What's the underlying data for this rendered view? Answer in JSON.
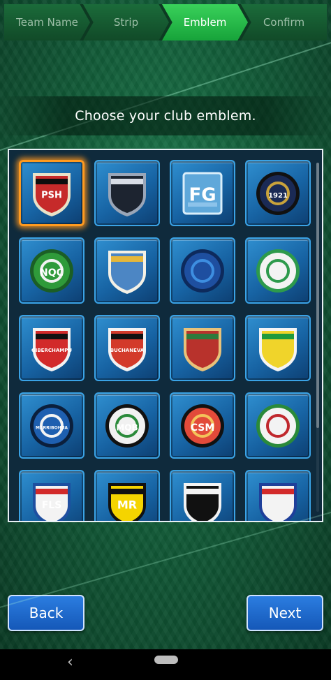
{
  "steps": [
    {
      "label": "Team Name"
    },
    {
      "label": "Strip"
    },
    {
      "label": "Emblem"
    },
    {
      "label": "Confirm"
    }
  ],
  "active_step": "Emblem",
  "instruction": "Choose your club emblem.",
  "emblems": [
    {
      "id": "psh",
      "text": "PSH",
      "icon": "psh-shield-crest",
      "selected": true
    },
    {
      "id": "lion",
      "text": "",
      "icon": "lion-head-crest",
      "selected": false
    },
    {
      "id": "fg",
      "text": "FG",
      "icon": "fg-monogram-crest",
      "selected": false
    },
    {
      "id": "herismakhgia",
      "text": "1921",
      "icon": "snake-scarab-crest",
      "selected": false
    },
    {
      "id": "nqc",
      "text": "NQC",
      "icon": "nqc-star-crest",
      "selected": false
    },
    {
      "id": "gharnetova",
      "text": "",
      "icon": "keys-shield-crest",
      "selected": false
    },
    {
      "id": "round-ball",
      "text": "",
      "icon": "blue-round-ball-crest",
      "selected": false
    },
    {
      "id": "celtic",
      "text": "",
      "icon": "green-white-round-crest",
      "selected": false
    },
    {
      "id": "giberchampu",
      "text": "GIBERCHAMPU",
      "icon": "red-black-stripes-crest",
      "selected": false
    },
    {
      "id": "buchaneva",
      "text": "BUCHANEVA",
      "icon": "castle-shield-crest",
      "selected": false
    },
    {
      "id": "monogram",
      "text": "",
      "icon": "red-green-monogram-crest",
      "selected": false
    },
    {
      "id": "green-yellow",
      "text": "",
      "icon": "green-yellow-shield-crest",
      "selected": false
    },
    {
      "id": "marribohua",
      "text": "MARRIBOHUA",
      "icon": "blue-round-crest",
      "selected": false
    },
    {
      "id": "mqb",
      "text": "MQB",
      "icon": "mqb-round-crest",
      "selected": false
    },
    {
      "id": "csm",
      "text": "CSM",
      "icon": "cosmopolitia-crest",
      "selected": false
    },
    {
      "id": "laurel",
      "text": "",
      "icon": "laurel-round-crest",
      "selected": false
    },
    {
      "id": "fls",
      "text": "FLS",
      "icon": "fls-shield-crest",
      "selected": false
    },
    {
      "id": "mr",
      "text": "MR",
      "icon": "yellow-black-mr-crest",
      "selected": false
    },
    {
      "id": "checkered",
      "text": "",
      "icon": "checkered-shield-crest",
      "selected": false
    },
    {
      "id": "red-blue",
      "text": "",
      "icon": "red-blue-shield-crest",
      "selected": false
    }
  ],
  "buttons": {
    "back": "Back",
    "next": "Next"
  },
  "system_nav": {
    "back_glyph": "‹"
  },
  "colors": {
    "accent_active_step": "#2fc24c",
    "selection_glow": "#ff9a1f",
    "tile_blue": "#1f6fb3",
    "button_blue": "#1f6fd0"
  }
}
